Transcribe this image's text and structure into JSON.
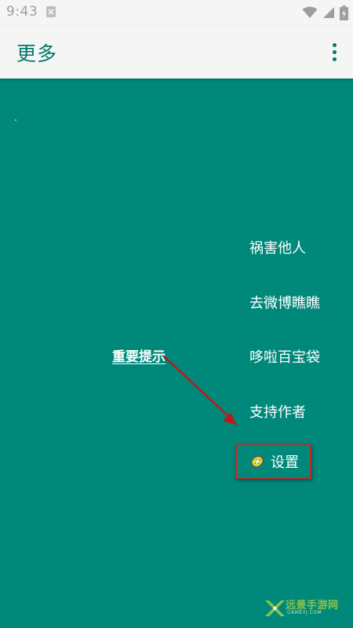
{
  "status_bar": {
    "time": "9:43",
    "notification_icon": "notification-icon",
    "wifi_icon": "wifi-icon",
    "signal_icon": "signal-icon",
    "battery_icon": "battery-icon"
  },
  "app_bar": {
    "title": "更多",
    "overflow_icon": "more-vert-icon"
  },
  "menu": {
    "items": [
      {
        "label": "祸害他人"
      },
      {
        "label": "去微博瞧瞧"
      },
      {
        "label": "哆啦百宝袋"
      },
      {
        "label": "支持作者"
      }
    ],
    "settings": {
      "label": "设置",
      "icon": "kiwi-icon"
    }
  },
  "annotation": {
    "hint": "重要提示",
    "arrow_icon": "arrow-icon"
  },
  "watermark": {
    "name": "远景手游网",
    "domain": "GAMEYJ.COM"
  },
  "colors": {
    "background": "#00897b",
    "app_bar": "#f5f5f5",
    "title": "#00796b",
    "highlight_border": "#c62828",
    "arrow": "#b71c1c"
  }
}
